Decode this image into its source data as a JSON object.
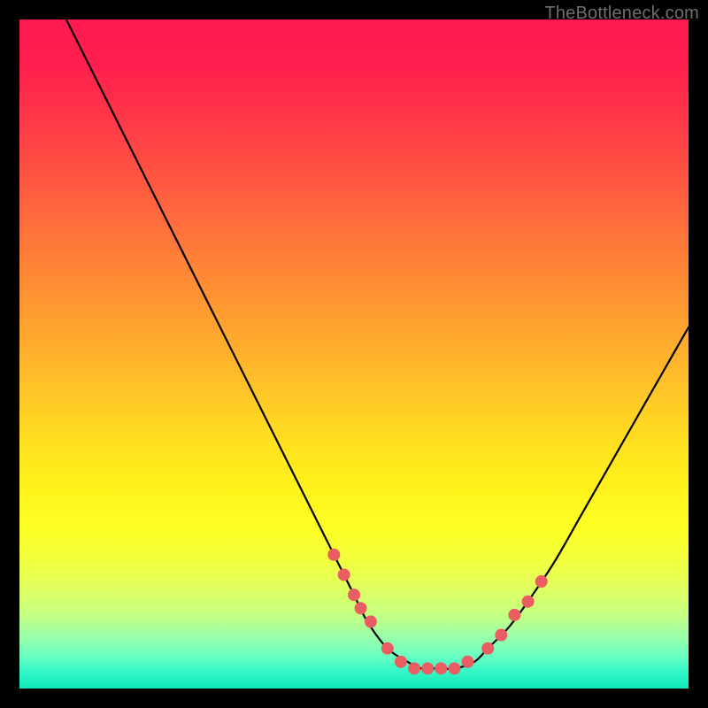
{
  "watermark": {
    "text": "TheBottleneck.com"
  },
  "chart_data": {
    "type": "line",
    "title": "",
    "xlabel": "",
    "ylabel": "",
    "xlim": [
      0,
      100
    ],
    "ylim": [
      0,
      100
    ],
    "series": [
      {
        "name": "bottleneck-curve",
        "x": [
          7,
          10,
          15,
          20,
          25,
          30,
          35,
          40,
          45,
          48,
          50,
          52,
          55,
          58,
          60,
          62,
          65,
          68,
          70,
          73,
          76,
          80,
          84,
          88,
          92,
          96,
          100
        ],
        "values": [
          100,
          94,
          84,
          74,
          64,
          54,
          44,
          34,
          24,
          18,
          14,
          10,
          6,
          4,
          3,
          3,
          3,
          4,
          6,
          9,
          13,
          19,
          26,
          33,
          40,
          47,
          54
        ]
      }
    ],
    "markers": {
      "name": "beads",
      "x": [
        47,
        48.5,
        50,
        51,
        52.5,
        55,
        57,
        59,
        61,
        63,
        65,
        67,
        70,
        72,
        74,
        76,
        78
      ],
      "values": [
        20,
        17,
        14,
        12,
        10,
        6,
        4,
        3,
        3,
        3,
        3,
        4,
        6,
        8,
        11,
        13,
        16
      ]
    }
  }
}
